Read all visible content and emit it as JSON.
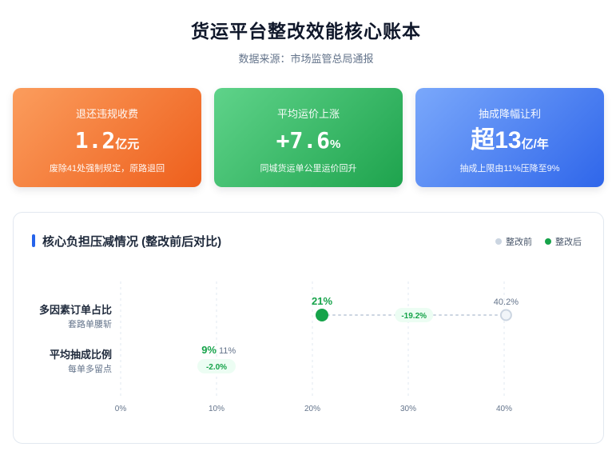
{
  "header": {
    "title": "货运平台整改效能核心账本",
    "subtitle": "数据来源：市场监管总局通报"
  },
  "cards": [
    {
      "label": "退还违规收费",
      "value": "1.2",
      "unit": "亿元",
      "desc": "废除41处强制规定，原路退回",
      "color": "#f47a3a"
    },
    {
      "label": "平均运价上涨",
      "value": "+7.6",
      "unit": "%",
      "desc": "同城货运单公里运价回升",
      "color": "#2bb55c"
    },
    {
      "label": "抽成降幅让利",
      "value": "超13",
      "unit": "亿/年",
      "desc": "抽成上限由11%压降至9%",
      "color": "#3f7cf2"
    }
  ],
  "panel": {
    "title": "核心负担压减情况 (整改前后对比)",
    "legend_before": "整改前",
    "legend_after": "整改后"
  },
  "chart_data": {
    "type": "dumbbell",
    "title": "核心负担压减情况 (整改前后对比)",
    "xlim": [
      0,
      40
    ],
    "x_ticks": [
      0,
      10,
      20,
      30,
      40
    ],
    "x_tick_labels": [
      "0%",
      "10%",
      "20%",
      "30%",
      "40%"
    ],
    "grid": true,
    "legend_position": "top-right",
    "series": [
      {
        "name": "整改前",
        "color": "#cbd5e1",
        "values": [
          40.2,
          11
        ]
      },
      {
        "name": "整改后",
        "color": "#16a34a",
        "values": [
          21,
          9
        ]
      }
    ],
    "categories": [
      {
        "label": "多因素订单占比",
        "sub": "套路单腰斩",
        "before": 40.2,
        "after": 21,
        "before_label": "40.2%",
        "after_label": "21%",
        "change_label": "-19.2%"
      },
      {
        "label": "平均抽成比例",
        "sub": "每单多留点",
        "before": 11,
        "after": 9,
        "before_label": "11%",
        "after_label": "9%",
        "change_label": "-2.0%"
      }
    ]
  }
}
